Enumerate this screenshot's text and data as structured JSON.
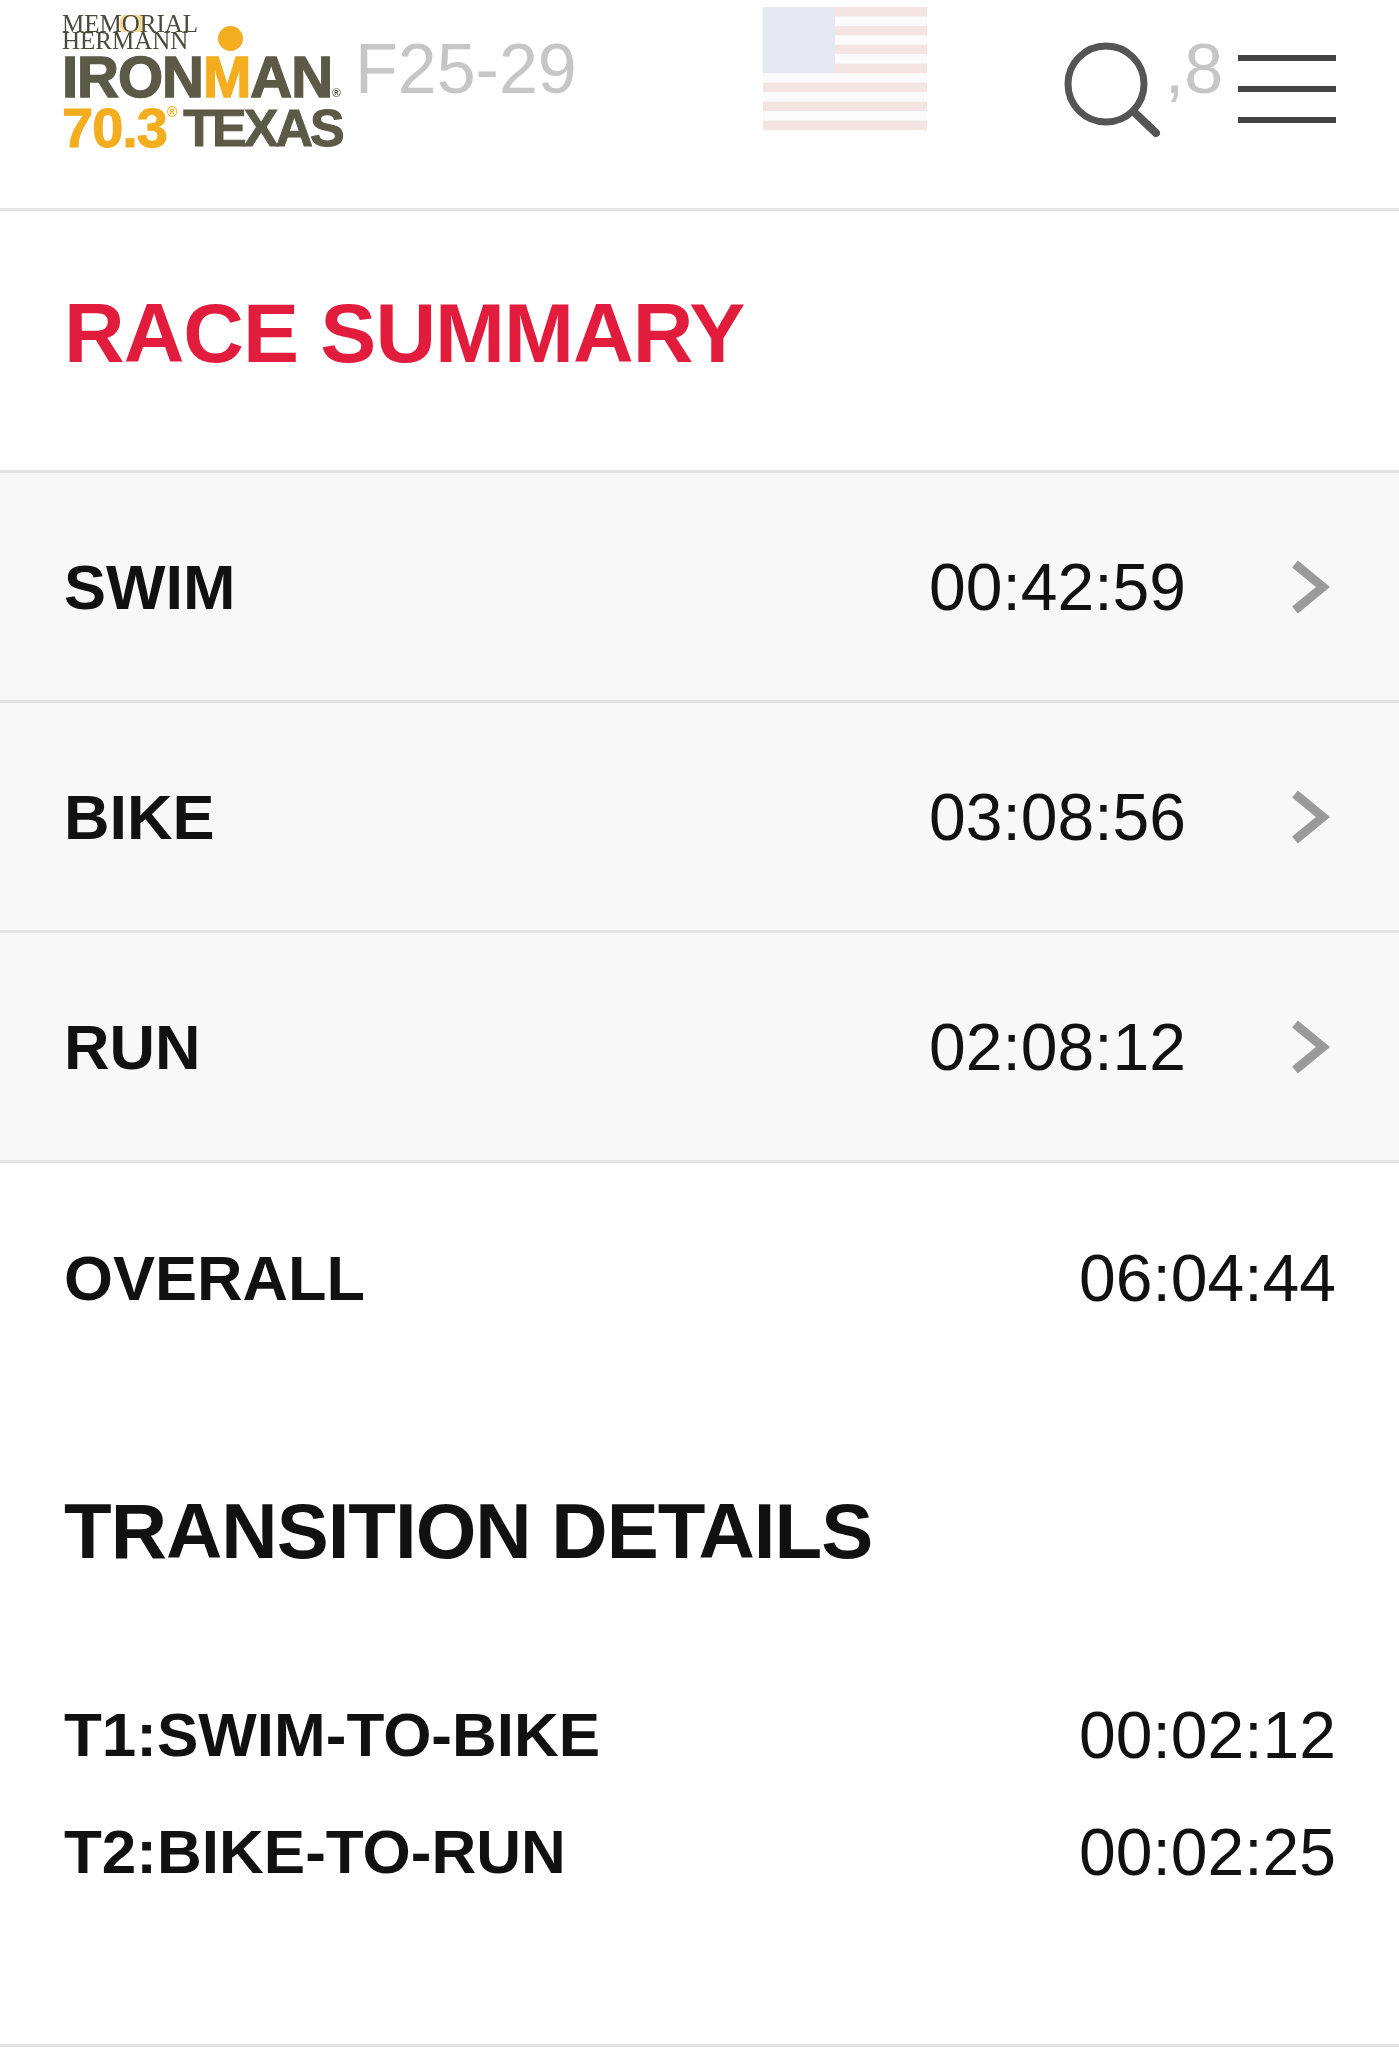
{
  "header": {
    "logo": {
      "sponsor": [
        "MEMORIAL",
        "HERMANN"
      ],
      "brand": [
        {
          "text": "IRON",
          "accent": false
        },
        {
          "text": "M",
          "accent": true
        },
        {
          "text": "AN",
          "accent": false
        }
      ],
      "brand_mark": "®",
      "distance": "70.3",
      "distance_mark": "®",
      "location": "TEXAS"
    },
    "background_stats": [
      "F25-29",
      ",8"
    ]
  },
  "race_summary": {
    "title": "RACE SUMMARY",
    "legs": [
      {
        "name": "SWIM",
        "time": "00:42:59"
      },
      {
        "name": "BIKE",
        "time": "03:08:56"
      },
      {
        "name": "RUN",
        "time": "02:08:12"
      }
    ],
    "overall": {
      "label": "OVERALL",
      "time": "06:04:44"
    }
  },
  "transition_details": {
    "title": "TRANSITION DETAILS",
    "items": [
      {
        "label": "T1:SWIM-TO-BIKE",
        "time": "00:02:12"
      },
      {
        "label": "T2:BIKE-TO-RUN",
        "time": "00:02:25"
      }
    ]
  }
}
